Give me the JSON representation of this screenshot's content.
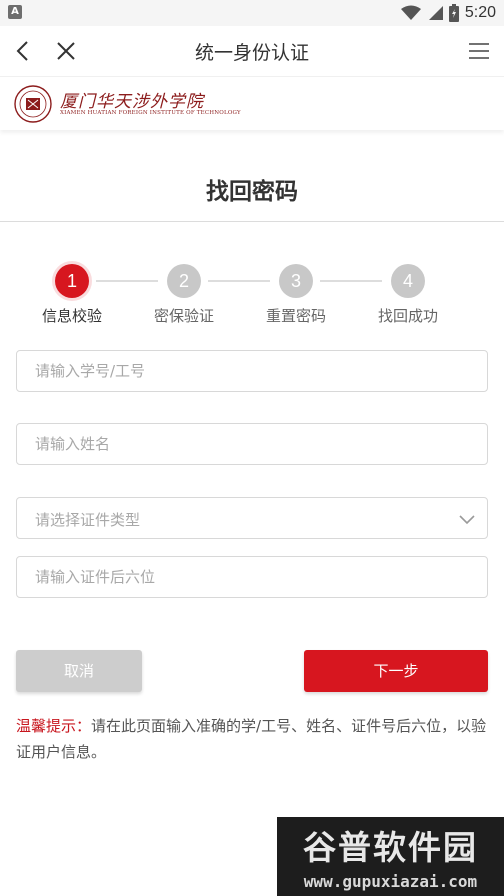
{
  "status_bar": {
    "time": "5:20",
    "notification_icon": "a-icon",
    "notification_glyph": "A"
  },
  "nav": {
    "title": "统一身份认证",
    "back_icon": "chevron-left-icon",
    "close_icon": "close-icon",
    "menu_icon": "hamburger-menu-icon"
  },
  "school": {
    "name": "厦门华天涉外学院",
    "english_name": "XIAMEN HUATIAN FOREIGN INSTITUTE OF TECHNOLOGY",
    "accent": "#8c1c1c"
  },
  "page": {
    "title": "找回密码"
  },
  "steps": [
    {
      "number": "1",
      "label": "信息校验",
      "active": true
    },
    {
      "number": "2",
      "label": "密保验证",
      "active": false
    },
    {
      "number": "3",
      "label": "重置密码",
      "active": false
    },
    {
      "number": "4",
      "label": "找回成功",
      "active": false
    }
  ],
  "form": {
    "id_number": {
      "placeholder": "请输入学号/工号",
      "value": ""
    },
    "name": {
      "placeholder": "请输入姓名",
      "value": ""
    },
    "cert_type": {
      "placeholder": "请选择证件类型",
      "value": ""
    },
    "cert_last6": {
      "placeholder": "请输入证件后六位",
      "value": ""
    }
  },
  "buttons": {
    "cancel": "取消",
    "next": "下一步"
  },
  "tip": {
    "label": "温馨提示：",
    "text": "请在此页面输入准确的学/工号、姓名、证件号后六位，以验证用户信息。"
  },
  "watermark": {
    "title": "谷普软件园",
    "url": "www.gupuxiazai.com"
  },
  "colors": {
    "primary": "#d7161f",
    "disabled": "#cdcdcd",
    "step_inactive": "#c8c8c8"
  }
}
